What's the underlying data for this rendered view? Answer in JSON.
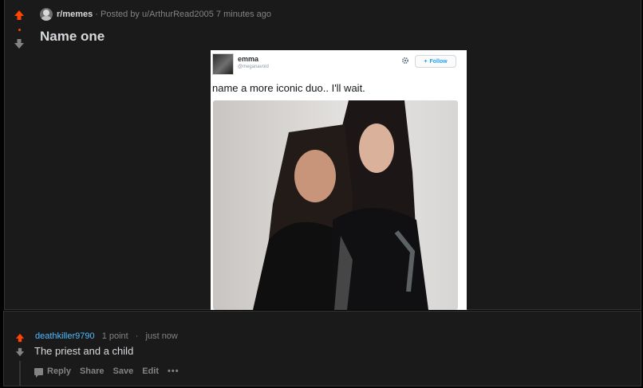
{
  "post": {
    "subreddit": "r/memes",
    "posted_by": "· Posted by u/ArthurRead2005 7 minutes ago",
    "title": "Name one",
    "image": {
      "display_name": "emma",
      "handle": "@meganavoid",
      "follow_label": "Follow",
      "tweet_text": "name a more iconic duo.. I'll wait."
    }
  },
  "comment": {
    "author": "deathkiller9790",
    "score": "1 point",
    "separator": "·",
    "time": "just now",
    "body": "The priest and a child",
    "actions": {
      "reply": "Reply",
      "share": "Share",
      "save": "Save",
      "edit": "Edit",
      "more": "•••"
    }
  },
  "colors": {
    "upvote_active": "#ff4500",
    "downvote": "#818384",
    "author_link": "#4fbcff",
    "card_bg": "#1a1a1b"
  }
}
